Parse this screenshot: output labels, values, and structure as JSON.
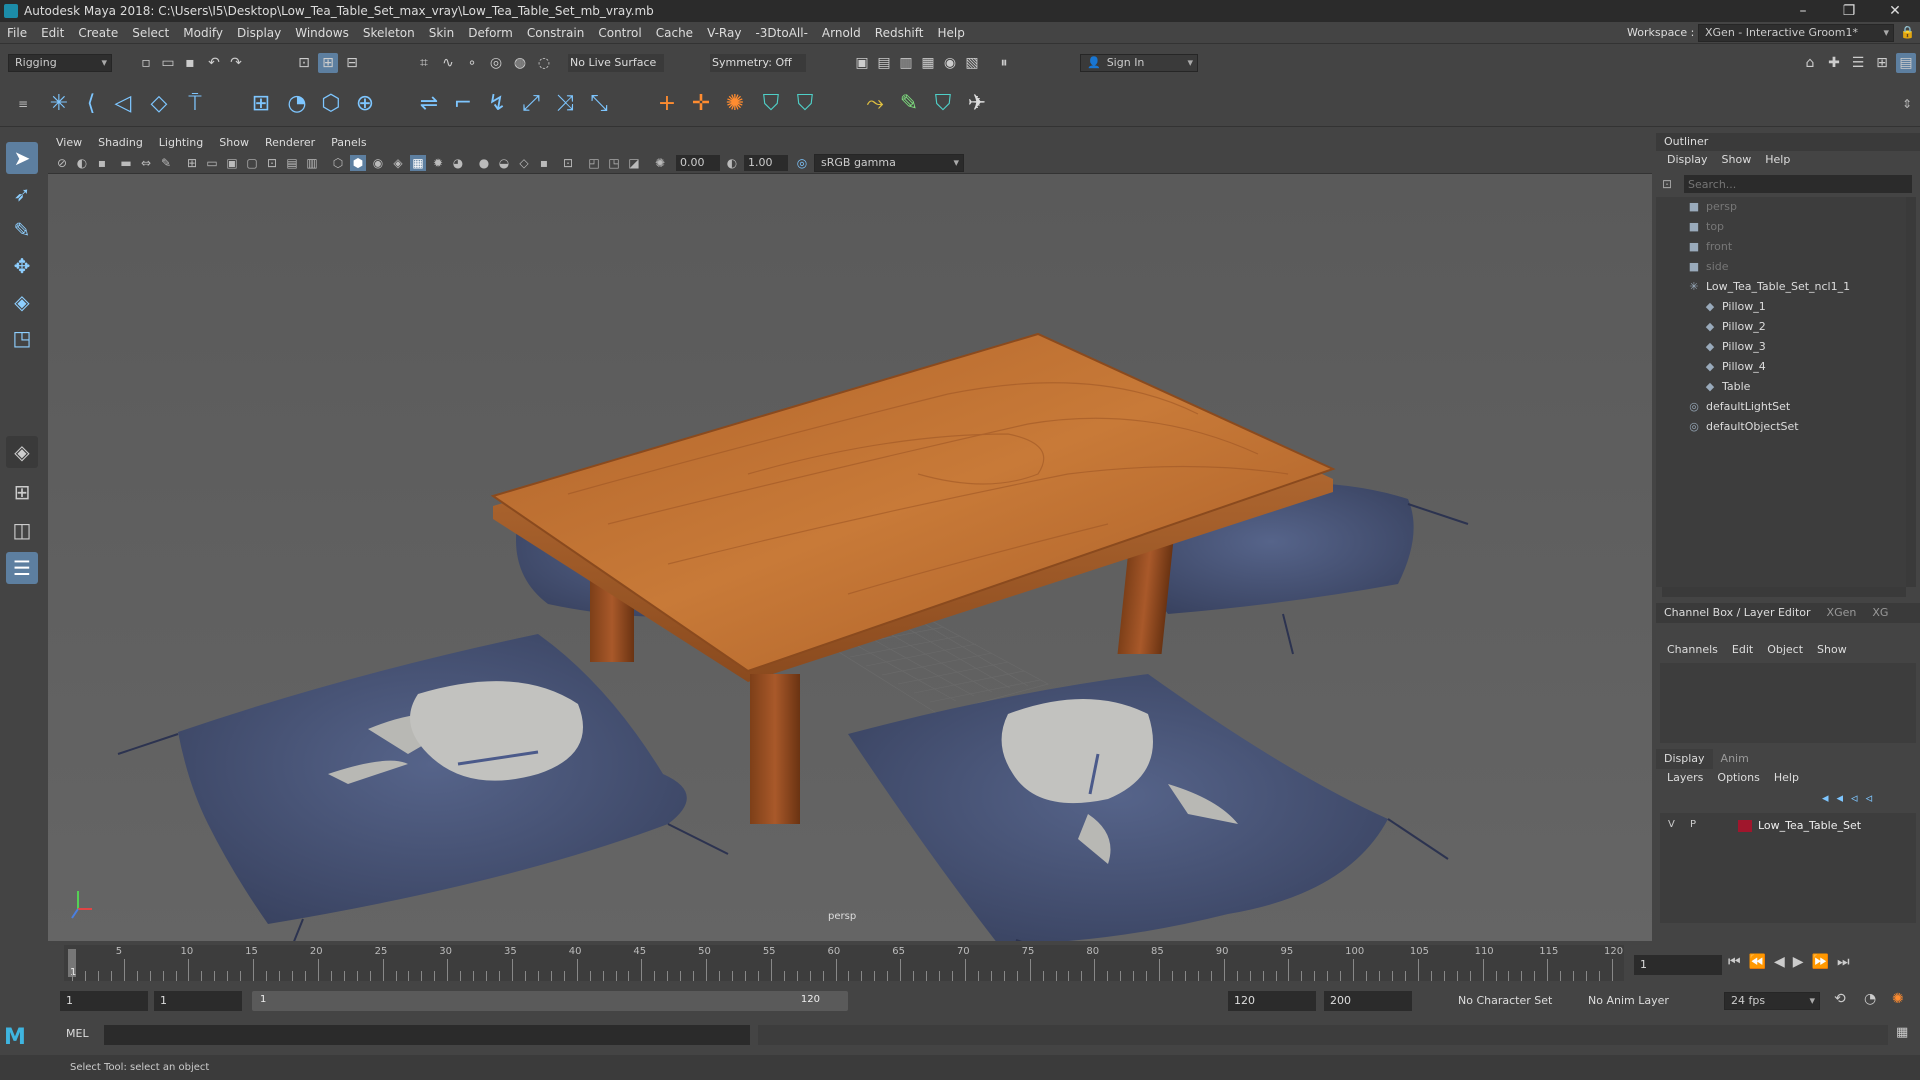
{
  "window": {
    "title": "Autodesk Maya 2018: C:\\Users\\I5\\Desktop\\Low_Tea_Table_Set_max_vray\\Low_Tea_Table_Set_mb_vray.mb"
  },
  "menu": [
    "File",
    "Edit",
    "Create",
    "Select",
    "Modify",
    "Display",
    "Windows",
    "Skeleton",
    "Skin",
    "Deform",
    "Constrain",
    "Control",
    "Cache",
    "V-Ray",
    "-3DtoAll-",
    "Arnold",
    "Redshift",
    "Help"
  ],
  "workspace": {
    "label": "Workspace :",
    "value": "XGen - Interactive Groom1*"
  },
  "statusline": {
    "mode": "Rigging",
    "live_surface": "No Live Surface",
    "symmetry": "Symmetry: Off",
    "sign_in": "Sign In"
  },
  "viewport": {
    "menu": [
      "View",
      "Shading",
      "Lighting",
      "Show",
      "Renderer",
      "Panels"
    ],
    "exposure": "0.00",
    "gamma": "1.00",
    "color_space": "sRGB gamma",
    "camera_label": "persp"
  },
  "outliner": {
    "title": "Outliner",
    "menu": [
      "Display",
      "Show",
      "Help"
    ],
    "search_placeholder": "Search...",
    "items": [
      {
        "label": "persp",
        "dim": true,
        "indent": 0,
        "icon": "camera-icon"
      },
      {
        "label": "top",
        "dim": true,
        "indent": 0,
        "icon": "camera-icon"
      },
      {
        "label": "front",
        "dim": true,
        "indent": 0,
        "icon": "camera-icon"
      },
      {
        "label": "side",
        "dim": true,
        "indent": 0,
        "icon": "camera-icon"
      },
      {
        "label": "Low_Tea_Table_Set_ncl1_1",
        "dim": false,
        "indent": 0,
        "icon": "group-icon"
      },
      {
        "label": "Pillow_1",
        "dim": false,
        "indent": 1,
        "icon": "mesh-icon"
      },
      {
        "label": "Pillow_2",
        "dim": false,
        "indent": 1,
        "icon": "mesh-icon"
      },
      {
        "label": "Pillow_3",
        "dim": false,
        "indent": 1,
        "icon": "mesh-icon"
      },
      {
        "label": "Pillow_4",
        "dim": false,
        "indent": 1,
        "icon": "mesh-icon"
      },
      {
        "label": "Table",
        "dim": false,
        "indent": 1,
        "icon": "mesh-icon"
      },
      {
        "label": "defaultLightSet",
        "dim": false,
        "indent": 0,
        "icon": "set-icon"
      },
      {
        "label": "defaultObjectSet",
        "dim": false,
        "indent": 0,
        "icon": "set-icon"
      }
    ]
  },
  "channelbox": {
    "tabs": [
      "Channel Box / Layer Editor",
      "XGen",
      "XG"
    ],
    "menu": [
      "Channels",
      "Edit",
      "Object",
      "Show"
    ],
    "layer_tabs": [
      "Display",
      "Anim"
    ],
    "layer_menu": [
      "Layers",
      "Options",
      "Help"
    ],
    "layer": {
      "v": "V",
      "p": "P",
      "name": "Low_Tea_Table_Set",
      "color": "#a0162c"
    }
  },
  "timeline": {
    "ticks": [
      "5",
      "10",
      "15",
      "20",
      "25",
      "30",
      "35",
      "40",
      "45",
      "50",
      "55",
      "60",
      "65",
      "70",
      "75",
      "80",
      "85",
      "90",
      "95",
      "100",
      "105",
      "110",
      "115",
      "120"
    ],
    "current_frame": "1",
    "start_mark": "1"
  },
  "range": {
    "start": "1",
    "playback_start": "1",
    "range_start": "1",
    "range_end": "120",
    "playback_end": "120",
    "end": "200",
    "character_set": "No Character Set",
    "anim_layer": "No Anim Layer",
    "fps": "24 fps"
  },
  "cmd": {
    "label": "MEL"
  },
  "help": {
    "text": "Select Tool: select an object"
  }
}
